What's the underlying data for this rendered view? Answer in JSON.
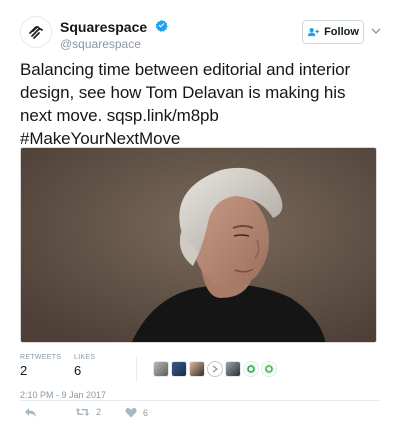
{
  "account": {
    "display_name": "Squarespace",
    "handle": "@squarespace",
    "verified": true
  },
  "follow_button": {
    "label": "Follow",
    "icon": "add-person-icon"
  },
  "tweet": {
    "text": "Balancing time between editorial and interior design, see how Tom Delavan is making his next move. sqsp.link/m8pb #MakeYourNextMove"
  },
  "stats": {
    "retweets_label": "RETWEETS",
    "retweets_value": "2",
    "likes_label": "LIKES",
    "likes_value": "6"
  },
  "timestamp": "2:10 PM - 9 Jan 2017",
  "actions": {
    "reply_icon": "reply-icon",
    "retweet_icon": "retweet-icon",
    "retweet_count": "2",
    "like_icon": "heart-icon",
    "like_count": "6"
  },
  "colors": {
    "verified_blue": "#1da1f2",
    "muted_text": "#8899a6",
    "border": "#e6ecf0"
  }
}
